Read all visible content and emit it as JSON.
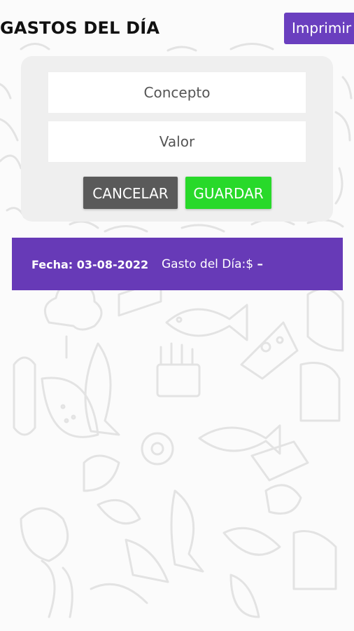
{
  "header": {
    "title": "GASTOS DEL DÍA",
    "print_label": "Imprimir"
  },
  "form": {
    "concepto_placeholder": "Concepto",
    "valor_placeholder": "Valor",
    "cancel_label": "CANCELAR",
    "save_label": "GUARDAR"
  },
  "summary": {
    "date_text": "Fecha: 03-08-2022",
    "expense_label": "Gasto del Día:$",
    "expense_value": "–"
  },
  "colors": {
    "accent": "#673ab7",
    "save": "#28d92a",
    "cancel": "#5a5a5a"
  }
}
